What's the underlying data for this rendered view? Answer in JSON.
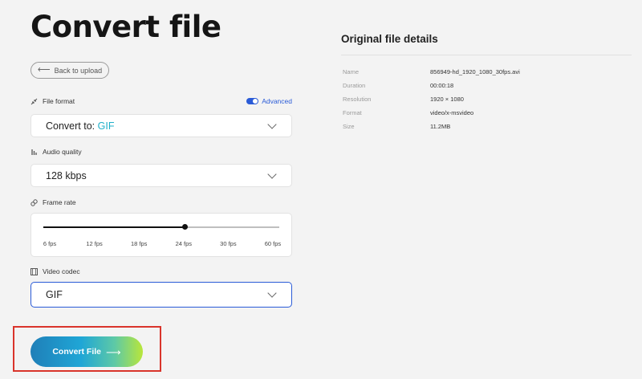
{
  "page": {
    "title": "Convert file",
    "back_label": "Back to upload"
  },
  "file_format": {
    "label": "File format",
    "advanced_label": "Advanced",
    "advanced_on": true,
    "select_prefix": "Convert to:",
    "select_value": "GIF"
  },
  "audio_quality": {
    "label": "Audio quality",
    "select_value": "128 kbps"
  },
  "frame_rate": {
    "label": "Frame rate",
    "options": [
      "6 fps",
      "12 fps",
      "18 fps",
      "24 fps",
      "30 fps",
      "60 fps"
    ],
    "selected": "24 fps",
    "selected_index": 3
  },
  "video_codec": {
    "label": "Video codec",
    "select_value": "GIF"
  },
  "convert_button": {
    "label": "Convert File"
  },
  "details": {
    "title": "Original file details",
    "rows": [
      {
        "key": "Name",
        "value": "856949-hd_1920_1080_30fps.avi"
      },
      {
        "key": "Duration",
        "value": "00:00:18"
      },
      {
        "key": "Resolution",
        "value": "1920 × 1080"
      },
      {
        "key": "Format",
        "value": "video/x-msvideo"
      },
      {
        "key": "Size",
        "value": "11.2MB"
      }
    ]
  },
  "colors": {
    "accent_blue": "#2a5bd7",
    "accent_teal": "#21b0c9",
    "highlight_red": "#d9342b",
    "background": "#f3f3f3"
  },
  "icons": {
    "back": "arrow-left-icon",
    "file_format": "compress-arrows-icon",
    "audio_quality": "equalizer-icon",
    "frame_rate": "link-icon",
    "video_codec": "film-icon",
    "dropdown": "chevron-down-icon",
    "convert": "arrow-right-icon"
  }
}
